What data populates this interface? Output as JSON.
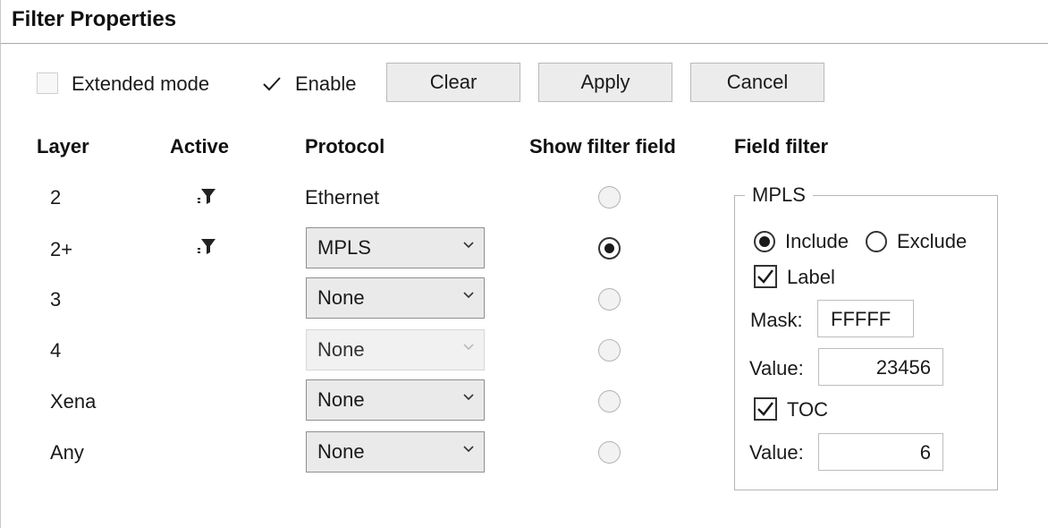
{
  "title": "Filter Properties",
  "toolbar": {
    "extended_mode": {
      "label": "Extended mode",
      "checked": false
    },
    "enable": {
      "label": "Enable",
      "checked": true
    },
    "clear_label": "Clear",
    "apply_label": "Apply",
    "cancel_label": "Cancel"
  },
  "columns": {
    "layer": "Layer",
    "active": "Active",
    "protocol": "Protocol",
    "show_filter_field": "Show filter field",
    "field_filter": "Field filter"
  },
  "rows": [
    {
      "layer": "2",
      "active": true,
      "protocol": "Ethernet",
      "editable": false,
      "show_field": false
    },
    {
      "layer": "2+",
      "active": true,
      "protocol": "MPLS",
      "editable": true,
      "show_field": true
    },
    {
      "layer": "3",
      "active": false,
      "protocol": "None",
      "editable": true,
      "show_field": false
    },
    {
      "layer": "4",
      "active": false,
      "protocol": "None",
      "editable": true,
      "disabled": true,
      "show_field": false
    },
    {
      "layer": "Xena",
      "active": false,
      "protocol": "None",
      "editable": true,
      "show_field": false
    },
    {
      "layer": "Any",
      "active": false,
      "protocol": "None",
      "editable": true,
      "show_field": false
    }
  ],
  "field_filter": {
    "group_title": "MPLS",
    "include_label": "Include",
    "exclude_label": "Exclude",
    "mode": "include",
    "label_checkbox": {
      "label": "Label",
      "checked": true
    },
    "mask_label": "Mask:",
    "mask_value": "FFFFF",
    "label_value_label": "Value:",
    "label_value": "23456",
    "toc_checkbox": {
      "label": "TOC",
      "checked": true
    },
    "toc_value_label": "Value:",
    "toc_value": "6"
  },
  "icons": {
    "active": "filter-funnel-icon",
    "dropdown": "chevron-down-icon",
    "check": "checkmark-icon"
  }
}
